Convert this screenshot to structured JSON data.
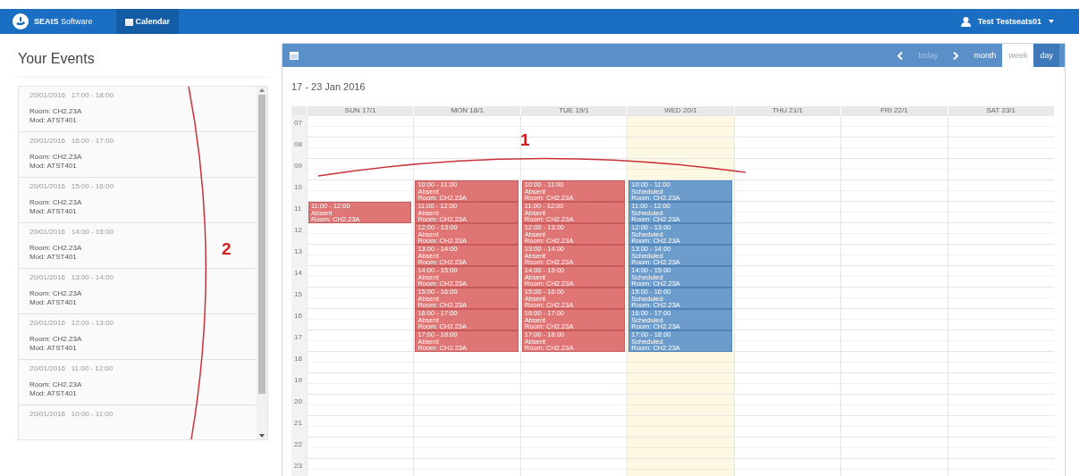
{
  "navbar": {
    "brand": "**SEAtS** Software",
    "tabs": [
      {
        "label": "Calendar",
        "selected": true
      }
    ],
    "user": "Test Testseats01"
  },
  "events_panel": {
    "title": "Your Events",
    "items": [
      {
        "date": "20/01/2016   17:00 - 18:00",
        "room": "Room: CH2.23A",
        "module": "Mod: ATST401"
      },
      {
        "date": "20/01/2016   16:00 - 17:00",
        "room": "Room: CH2.23A",
        "module": "Mod: ATST401"
      },
      {
        "date": "20/01/2016   15:00 - 16:00",
        "room": "Room: CH2.23A",
        "module": "Mod: ATST401"
      },
      {
        "date": "20/01/2016   14:00 - 15:00",
        "room": "Room: CH2.23A",
        "module": "Mod: ATST401"
      },
      {
        "date": "20/01/2016   13:00 - 14:00",
        "room": "Room: CH2.23A",
        "module": "Mod: ATST401"
      },
      {
        "date": "20/01/2016   12:00 - 13:00",
        "room": "Room: CH2.23A",
        "module": "Mod: ATST401"
      },
      {
        "date": "20/01/2016   11:00 - 12:00",
        "room": "Room: CH2.23A",
        "module": "Mod: ATST401"
      },
      {
        "date": "20/01/2016   10:00 - 11:00"
      }
    ]
  },
  "calendar": {
    "toolbar": {
      "today": {
        "label": "today",
        "disabled": true
      },
      "views": [
        {
          "label": "month",
          "selected": false,
          "highlighted": false
        },
        {
          "label": "week",
          "selected": true,
          "highlighted": false
        },
        {
          "label": "day",
          "selected": false,
          "highlighted": true
        }
      ]
    },
    "range": "17 - 23 Jan 2016",
    "days": [
      {
        "label": "SUN 17/1",
        "today": false
      },
      {
        "label": "MON 18/1",
        "today": false
      },
      {
        "label": "TUE 19/1",
        "today": false
      },
      {
        "label": "WED 20/1",
        "today": true
      },
      {
        "label": "THU 21/1",
        "today": false
      },
      {
        "label": "FRI 22/1",
        "today": false
      },
      {
        "label": "SAT 23/1",
        "today": false
      }
    ],
    "hours": [
      {
        "label": "07",
        "cells": [
          null,
          null,
          null,
          null,
          null,
          null,
          null
        ]
      },
      {
        "label": "08",
        "cells": [
          null,
          null,
          null,
          null,
          null,
          null,
          null
        ]
      },
      {
        "label": "09",
        "cells": [
          null,
          null,
          null,
          null,
          null,
          null,
          null
        ]
      },
      {
        "label": "10",
        "cells": [
          null,
          {
            "kind": "absent",
            "time": "10:00 - 11:00",
            "status": "Absent",
            "room": "Room: CH2.23A"
          },
          {
            "kind": "absent",
            "time": "10:00 - 11:00",
            "status": "Absent",
            "room": "Room: CH2.23A"
          },
          {
            "kind": "scheduled",
            "time": "10:00 - 11:00",
            "status": "Scheduled",
            "room": "Room: CH2.23A"
          },
          null,
          null,
          null
        ]
      },
      {
        "label": "11",
        "cells": [
          {
            "kind": "absent",
            "time": "11:00 - 12:00",
            "status": "Absent",
            "room": "Room: CH2.23A"
          },
          {
            "kind": "absent",
            "time": "11:00 - 12:00",
            "status": "Absent",
            "room": "Room: CH2.23A"
          },
          {
            "kind": "absent",
            "time": "11:00 - 12:00",
            "status": "Absent",
            "room": "Room: CH2.23A"
          },
          {
            "kind": "scheduled",
            "time": "11:00 - 12:00",
            "status": "Scheduled",
            "room": "Room: CH2.23A"
          },
          null,
          null,
          null
        ]
      },
      {
        "label": "12",
        "cells": [
          null,
          {
            "kind": "absent",
            "time": "12:00 - 13:00",
            "status": "Absent",
            "room": "Room: CH2.23A"
          },
          {
            "kind": "absent",
            "time": "12:00 - 13:00",
            "status": "Absent",
            "room": "Room: CH2.23A"
          },
          {
            "kind": "scheduled",
            "time": "12:00 - 13:00",
            "status": "Scheduled",
            "room": "Room: CH2.23A"
          },
          null,
          null,
          null
        ]
      },
      {
        "label": "13",
        "cells": [
          null,
          {
            "kind": "absent",
            "time": "13:00 - 14:00",
            "status": "Absent",
            "room": "Room: CH2.23A"
          },
          {
            "kind": "absent",
            "time": "13:00 - 14:00",
            "status": "Absent",
            "room": "Room: CH2.23A"
          },
          {
            "kind": "scheduled",
            "time": "13:00 - 14:00",
            "status": "Scheduled",
            "room": "Room: CH2.23A"
          },
          null,
          null,
          null
        ]
      },
      {
        "label": "14",
        "cells": [
          null,
          {
            "kind": "absent",
            "time": "14:00 - 15:00",
            "status": "Absent",
            "room": "Room: CH2.23A"
          },
          {
            "kind": "absent",
            "time": "14:00 - 15:00",
            "status": "Absent",
            "room": "Room: CH2.23A"
          },
          {
            "kind": "scheduled",
            "time": "14:00 - 15:00",
            "status": "Scheduled",
            "room": "Room: CH2.23A"
          },
          null,
          null,
          null
        ]
      },
      {
        "label": "15",
        "cells": [
          null,
          {
            "kind": "absent",
            "time": "15:00 - 16:00",
            "status": "Absent",
            "room": "Room: CH2.23A"
          },
          {
            "kind": "absent",
            "time": "15:00 - 16:00",
            "status": "Absent",
            "room": "Room: CH2.23A"
          },
          {
            "kind": "scheduled",
            "time": "15:00 - 16:00",
            "status": "Scheduled",
            "room": "Room: CH2.23A"
          },
          null,
          null,
          null
        ]
      },
      {
        "label": "16",
        "cells": [
          null,
          {
            "kind": "absent",
            "time": "16:00 - 17:00",
            "status": "Absent",
            "room": "Room: CH2.23A"
          },
          {
            "kind": "absent",
            "time": "16:00 - 17:00",
            "status": "Absent",
            "room": "Room: CH2.23A"
          },
          {
            "kind": "scheduled",
            "time": "16:00 - 17:00",
            "status": "Scheduled",
            "room": "Room: CH2.23A"
          },
          null,
          null,
          null
        ]
      },
      {
        "label": "17",
        "cells": [
          null,
          {
            "kind": "absent",
            "time": "17:00 - 18:00",
            "status": "Absent",
            "room": "Room: CH2.23A"
          },
          {
            "kind": "absent",
            "time": "17:00 - 18:00",
            "status": "Absent",
            "room": "Room: CH2.23A"
          },
          {
            "kind": "scheduled",
            "time": "17:00 - 18:00",
            "status": "Scheduled",
            "room": "Room: CH2.23A"
          },
          null,
          null,
          null
        ]
      },
      {
        "label": "18",
        "cells": [
          null,
          null,
          null,
          null,
          null,
          null,
          null
        ]
      },
      {
        "label": "19",
        "cells": [
          null,
          null,
          null,
          null,
          null,
          null,
          null
        ]
      },
      {
        "label": "20",
        "cells": [
          null,
          null,
          null,
          null,
          null,
          null,
          null
        ]
      },
      {
        "label": "21",
        "cells": [
          null,
          null,
          null,
          null,
          null,
          null,
          null
        ]
      },
      {
        "label": "22",
        "cells": [
          null,
          null,
          null,
          null,
          null,
          null,
          null
        ]
      },
      {
        "label": "23",
        "cells": [
          null,
          null,
          null,
          null,
          null,
          null,
          null
        ]
      }
    ]
  },
  "annotations": [
    {
      "label": "1"
    },
    {
      "label": "2"
    }
  ]
}
